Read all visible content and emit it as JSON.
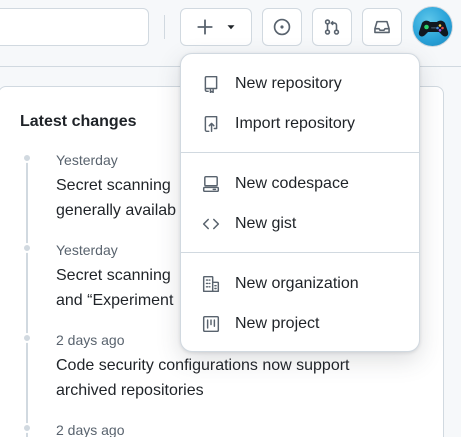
{
  "header": {
    "search_placeholder": "",
    "create_button": {
      "icon": "plus-icon",
      "caret_icon": "triangle-down-icon"
    },
    "issues_button": {
      "icon": "issue-opened-icon"
    },
    "pull_requests_button": {
      "icon": "git-pull-request-icon"
    },
    "inbox_button": {
      "icon": "inbox-icon"
    },
    "avatar": {
      "icon": "game-controller-avatar",
      "color": "#2aa3d9"
    }
  },
  "create_menu": {
    "groups": [
      [
        {
          "label": "New repository",
          "icon": "repo-icon"
        },
        {
          "label": "Import repository",
          "icon": "repo-push-icon"
        }
      ],
      [
        {
          "label": "New codespace",
          "icon": "codespaces-icon"
        },
        {
          "label": "New gist",
          "icon": "code-icon"
        }
      ],
      [
        {
          "label": "New organization",
          "icon": "organization-icon"
        },
        {
          "label": "New project",
          "icon": "project-icon"
        }
      ]
    ]
  },
  "changes": {
    "title": "Latest changes",
    "items": [
      {
        "date": "Yesterday",
        "lines": [
          "Secret scanning",
          "generally availab"
        ]
      },
      {
        "date": "Yesterday",
        "lines": [
          "Secret scanning",
          "and “Experiment"
        ]
      },
      {
        "date": "2 days ago",
        "lines": [
          "Code security configurations now support",
          "archived repositories"
        ]
      },
      {
        "date": "2 days ago",
        "lines": []
      }
    ]
  },
  "colors": {
    "border": "#d1d9e0",
    "text": "#1f2328",
    "muted": "#59636e",
    "icon": "#59636e"
  }
}
